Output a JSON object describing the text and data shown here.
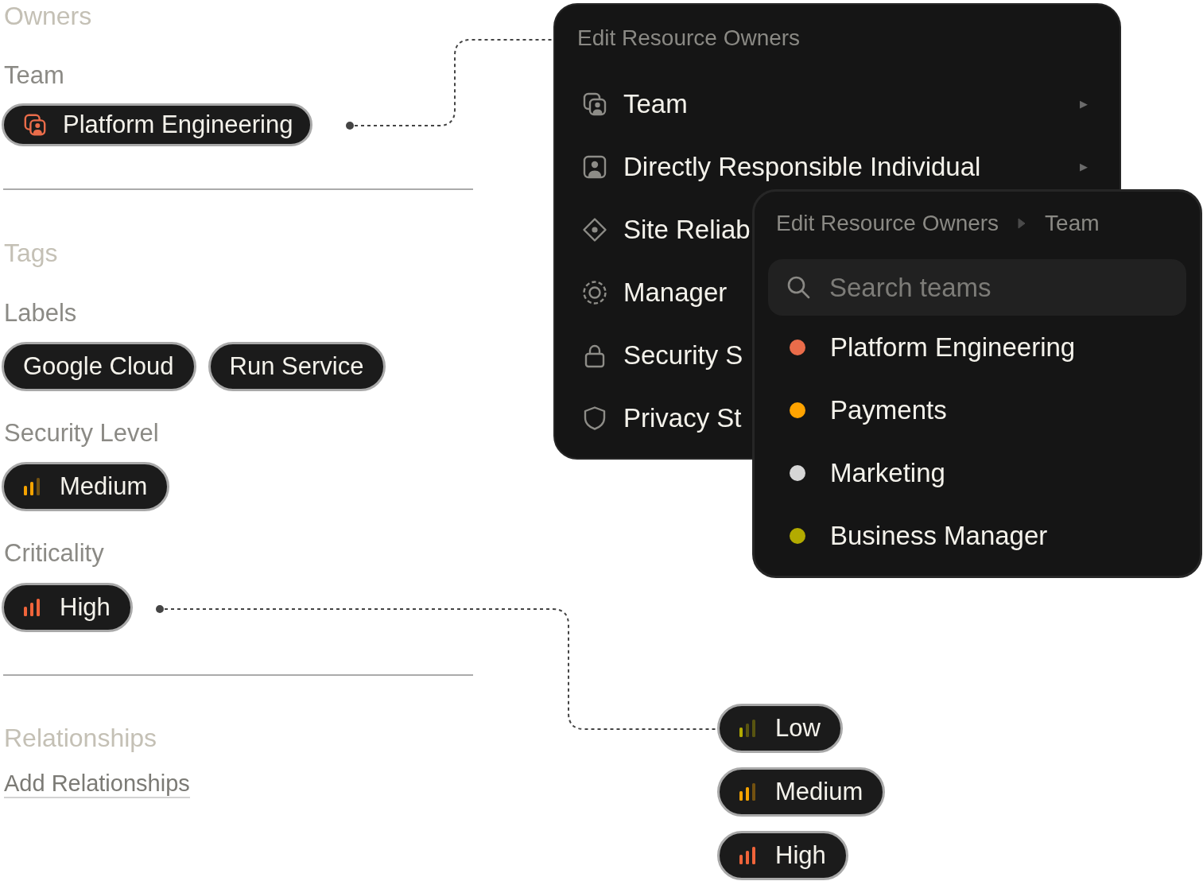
{
  "owners": {
    "heading": "Owners",
    "team_label": "Team",
    "team": {
      "label": "Platform Engineering",
      "color": "#ea6c4a"
    }
  },
  "tags": {
    "heading": "Tags",
    "labels_label": "Labels",
    "labels": [
      "Google Cloud",
      "Run Service"
    ],
    "security_level_label": "Security Level",
    "security_level": {
      "label": "Medium",
      "kind": "medium",
      "color": "#f5a300"
    },
    "criticality_label": "Criticality",
    "criticality": {
      "label": "High",
      "kind": "high",
      "color": "#f0643a"
    }
  },
  "relationships": {
    "heading": "Relationships",
    "link": "Add Relationships"
  },
  "owners_menu": {
    "title": "Edit Resource Owners",
    "items": [
      {
        "label": "Team",
        "kind": "cards",
        "arrow": "▶"
      },
      {
        "label": "Directly Responsible Individual",
        "kind": "person",
        "arrow": "▶"
      },
      {
        "label": "Site Reliab",
        "kind": "target"
      },
      {
        "label": "Manager",
        "kind": "ring"
      },
      {
        "label": "Security S",
        "kind": "lock"
      },
      {
        "label": "Privacy St",
        "kind": "shield"
      }
    ]
  },
  "team_menu": {
    "breadcrumb": [
      "Edit Resource Owners",
      "Team"
    ],
    "search": {
      "placeholder": "Search teams"
    },
    "teams": [
      {
        "name": "Platform Engineering",
        "color": "#ea6c4a"
      },
      {
        "name": "Payments",
        "color": "#ffa300"
      },
      {
        "name": "Marketing",
        "color": "#d6d6d6"
      },
      {
        "name": "Business Manager",
        "color": "#b3ab00"
      }
    ]
  },
  "criticality_options": [
    {
      "label": "Low",
      "kind": "low",
      "color": "#b3ab00"
    },
    {
      "label": "Medium",
      "kind": "medium",
      "color": "#f5a300"
    },
    {
      "label": "High",
      "kind": "high",
      "color": "#f0643a"
    }
  ]
}
